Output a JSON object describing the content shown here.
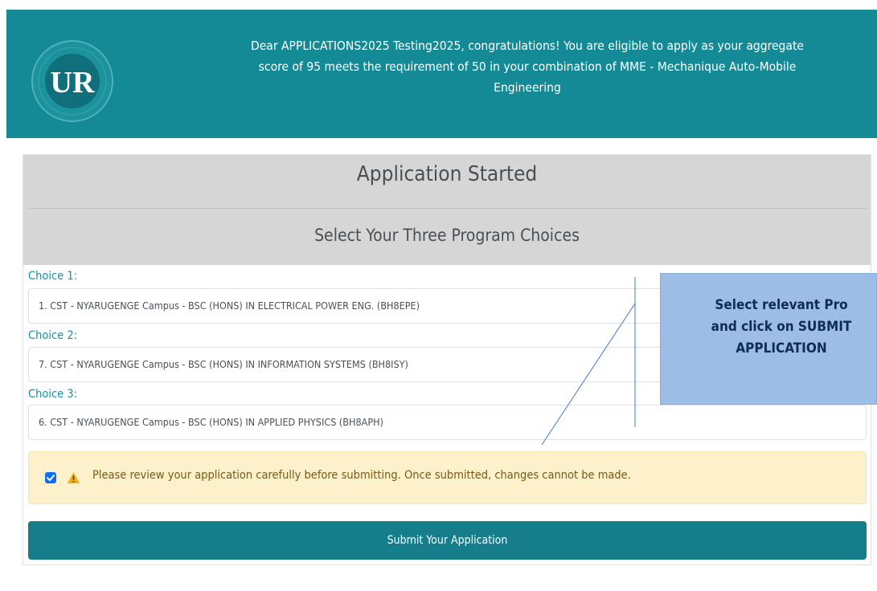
{
  "header": {
    "logo_text": "UR",
    "message_line1": "Dear APPLICATIONS2025 Testing2025, congratulations! You are eligible to apply as your aggregate",
    "message_line2": "score of 95 meets the requirement of 50 in your combination of MME - Mechanique Auto-Mobile",
    "message_line3": "Engineering"
  },
  "application": {
    "title": "Application Started",
    "subtitle": "Select Your Three Program Choices",
    "choices": [
      {
        "label": "Choice 1:",
        "value": "1. CST - NYARUGENGE Campus - BSC (HONS) IN ELECTRICAL POWER ENG. (BH8EPE)"
      },
      {
        "label": "Choice 2:",
        "value": "7. CST - NYARUGENGE Campus - BSC (HONS) IN INFORMATION SYSTEMS (BH8ISY)"
      },
      {
        "label": "Choice 3:",
        "value": "6. CST - NYARUGENGE Campus - BSC (HONS) IN APPLIED PHYSICS (BH8APH)"
      }
    ],
    "review_notice": "Please review your application carefully before submitting. Once submitted, changes cannot be made.",
    "review_checked": true,
    "submit_label": "Submit Your Application"
  },
  "callout": {
    "line1": "Select relevant Pro",
    "line2": "and click on SUBMIT",
    "line3": "APPLICATION"
  },
  "colors": {
    "header_bg": "#138a95",
    "panel_bg": "#d6d6d6",
    "label": "#1a8f9a",
    "alert_bg": "#fdf1cc",
    "button_bg": "#167d8a",
    "callout_bg": "#9dbde7"
  }
}
